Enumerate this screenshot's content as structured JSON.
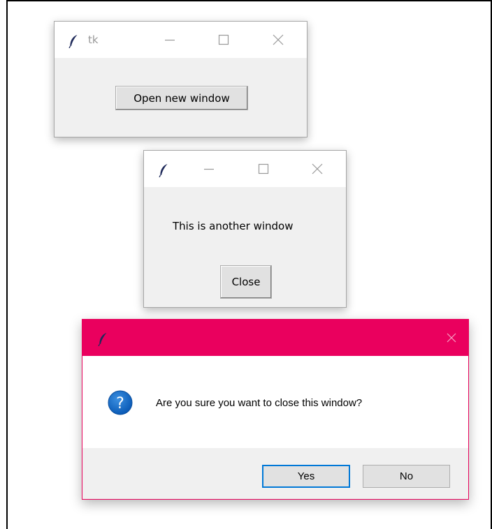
{
  "main_window": {
    "title": "tk",
    "open_button_label": "Open new window"
  },
  "second_window": {
    "message": "This is another window",
    "close_button_label": "Close"
  },
  "dialog": {
    "message": "Are you sure you want to close this window?",
    "icon": "question-icon",
    "yes_label": "Yes",
    "no_label": "No",
    "accent_color": "#ea005e"
  },
  "icons": {
    "app_icon": "feather-icon",
    "minimize": "minimize-icon",
    "maximize": "maximize-icon",
    "close": "close-icon"
  }
}
